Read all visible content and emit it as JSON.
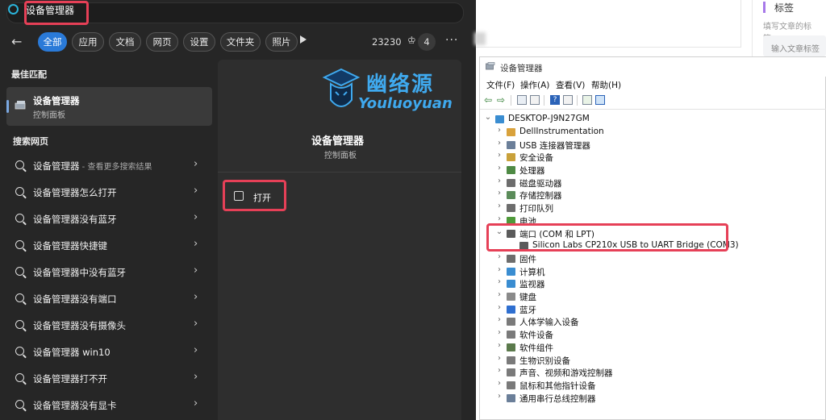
{
  "search": {
    "query": "设备管理器",
    "filters": [
      {
        "label": "全部",
        "active": true
      },
      {
        "label": "应用",
        "active": false
      },
      {
        "label": "文档",
        "active": false
      },
      {
        "label": "网页",
        "active": false
      },
      {
        "label": "设置",
        "active": false
      },
      {
        "label": "文件夹",
        "active": false
      },
      {
        "label": "照片",
        "active": false
      }
    ],
    "points": "23230",
    "badge_count": "4",
    "best_match_heading": "最佳匹配",
    "best_match": {
      "title": "设备管理器",
      "subtitle": "控制面板"
    },
    "web_heading": "搜索网页",
    "web_results": [
      {
        "text": "设备管理器",
        "suffix": " - 查看更多搜索结果"
      },
      {
        "text": "设备管理器怎么打开",
        "suffix": ""
      },
      {
        "text": "设备管理器没有蓝牙",
        "suffix": ""
      },
      {
        "text": "设备管理器快捷键",
        "suffix": ""
      },
      {
        "text": "设备管理器中没有蓝牙",
        "suffix": ""
      },
      {
        "text": "设备管理器没有端口",
        "suffix": ""
      },
      {
        "text": "设备管理器没有摄像头",
        "suffix": ""
      },
      {
        "text": "设备管理器 win10",
        "suffix": ""
      },
      {
        "text": "设备管理器打不开",
        "suffix": ""
      },
      {
        "text": "设备管理器没有显卡",
        "suffix": ""
      }
    ],
    "preview": {
      "title": "设备管理器",
      "subtitle": "控制面板",
      "open_label": "打开"
    },
    "watermark": {
      "cn": "幽络源",
      "en": "Youluoyuan"
    }
  },
  "editor": {
    "tags_label": "标签",
    "tags_hint": "填写文章的标签。",
    "tags_placeholder": "输入文章标签"
  },
  "device_manager": {
    "title": "设备管理器",
    "menu": [
      "文件(F)",
      "操作(A)",
      "查看(V)",
      "帮助(H)"
    ],
    "root": "DESKTOP-J9N27GM",
    "categories": [
      {
        "label": "DellInstrumentation",
        "expanded": false,
        "icon": "folder-icon",
        "color": "#d9a23c"
      },
      {
        "label": "USB 连接器管理器",
        "expanded": false,
        "icon": "usb-icon",
        "color": "#6b7f99"
      },
      {
        "label": "安全设备",
        "expanded": false,
        "icon": "key-icon",
        "color": "#c9a13a"
      },
      {
        "label": "处理器",
        "expanded": false,
        "icon": "cpu-icon",
        "color": "#4e8a44"
      },
      {
        "label": "磁盘驱动器",
        "expanded": false,
        "icon": "disk-icon",
        "color": "#6d6d6d"
      },
      {
        "label": "存储控制器",
        "expanded": false,
        "icon": "storage-icon",
        "color": "#5b8c5a"
      },
      {
        "label": "打印队列",
        "expanded": false,
        "icon": "printer-icon",
        "color": "#6d6d6d"
      },
      {
        "label": "电池",
        "expanded": false,
        "icon": "battery-icon",
        "color": "#4f9a3a"
      },
      {
        "label": "端口 (COM 和 LPT)",
        "expanded": true,
        "icon": "port-icon",
        "color": "#5b5b5b",
        "children": [
          {
            "label": "Silicon Labs CP210x USB to UART Bridge (COM3)",
            "icon": "port-icon",
            "color": "#5b5b5b"
          }
        ]
      },
      {
        "label": "固件",
        "expanded": false,
        "icon": "firmware-icon",
        "color": "#6d6d6d"
      },
      {
        "label": "计算机",
        "expanded": false,
        "icon": "computer-icon",
        "color": "#3a8dd1"
      },
      {
        "label": "监视器",
        "expanded": false,
        "icon": "monitor-icon",
        "color": "#3a8dd1"
      },
      {
        "label": "键盘",
        "expanded": false,
        "icon": "keyboard-icon",
        "color": "#8a8a8a"
      },
      {
        "label": "蓝牙",
        "expanded": false,
        "icon": "bluetooth-icon",
        "color": "#2f6fd0"
      },
      {
        "label": "人体学输入设备",
        "expanded": false,
        "icon": "hid-icon",
        "color": "#7a7a7a"
      },
      {
        "label": "软件设备",
        "expanded": false,
        "icon": "software-device-icon",
        "color": "#7a7a7a"
      },
      {
        "label": "软件组件",
        "expanded": false,
        "icon": "software-component-icon",
        "color": "#5b7a4c"
      },
      {
        "label": "生物识别设备",
        "expanded": false,
        "icon": "fingerprint-icon",
        "color": "#7a7a7a"
      },
      {
        "label": "声音、视频和游戏控制器",
        "expanded": false,
        "icon": "speaker-icon",
        "color": "#7a7a7a"
      },
      {
        "label": "鼠标和其他指针设备",
        "expanded": false,
        "icon": "mouse-icon",
        "color": "#7a7a7a"
      },
      {
        "label": "通用串行总线控制器",
        "expanded": false,
        "icon": "usb-controller-icon",
        "color": "#6b7f99"
      }
    ]
  }
}
